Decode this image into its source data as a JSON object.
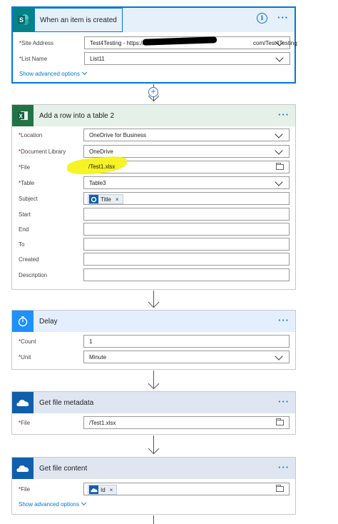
{
  "trigger": {
    "title": "When an item is created",
    "info_glyph": "i",
    "menu_glyph": "···",
    "fields": [
      {
        "label": "Site Address",
        "required": "*",
        "value": "Test4Testing - https://",
        "value_tail": "com/Test4Testing"
      },
      {
        "label": "List Name",
        "required": "*",
        "value": "List11"
      }
    ],
    "advanced": "Show advanced options"
  },
  "excel_step": {
    "title": "Add a row into a table 2",
    "menu_glyph": "···",
    "fields": [
      {
        "label": "Location",
        "required": "*",
        "value": "OneDrive for Business"
      },
      {
        "label": "Document Library",
        "required": "*",
        "value": "OneDrive"
      },
      {
        "label": "File",
        "required": "*",
        "value": "/Test1.xlsx"
      },
      {
        "label": "Table",
        "required": "*",
        "value": "Table3"
      },
      {
        "label": "Subject",
        "required": "",
        "token": "Title",
        "token_close": "×"
      },
      {
        "label": "Start",
        "required": ""
      },
      {
        "label": "End",
        "required": ""
      },
      {
        "label": "To",
        "required": ""
      },
      {
        "label": "Created",
        "required": ""
      },
      {
        "label": "Description",
        "required": ""
      }
    ]
  },
  "delay_step": {
    "title": "Delay",
    "menu_glyph": "···",
    "fields": [
      {
        "label": "Count",
        "required": "*",
        "value": "1"
      },
      {
        "label": "Unit",
        "required": "*",
        "value": "Minute"
      }
    ]
  },
  "metadata_step": {
    "title": "Get file metadata",
    "menu_glyph": "···",
    "fields": [
      {
        "label": "File",
        "required": "*",
        "value": "/Test1.xlsx"
      }
    ]
  },
  "content_step": {
    "title": "Get file content",
    "menu_glyph": "···",
    "fields": [
      {
        "label": "File",
        "required": "*",
        "token": "Id",
        "token_close": "×"
      }
    ],
    "advanced": "Show advanced options"
  },
  "colors": {
    "sharepoint": "#038387",
    "excel": "#217346",
    "delay": "#1e90ff",
    "onedrive": "#0f5fad",
    "accent": "#0078d4"
  },
  "icons": [
    "sharepoint-icon",
    "excel-icon",
    "timer-icon",
    "onedrive-icon",
    "add-step-icon",
    "arrow-down-icon"
  ]
}
